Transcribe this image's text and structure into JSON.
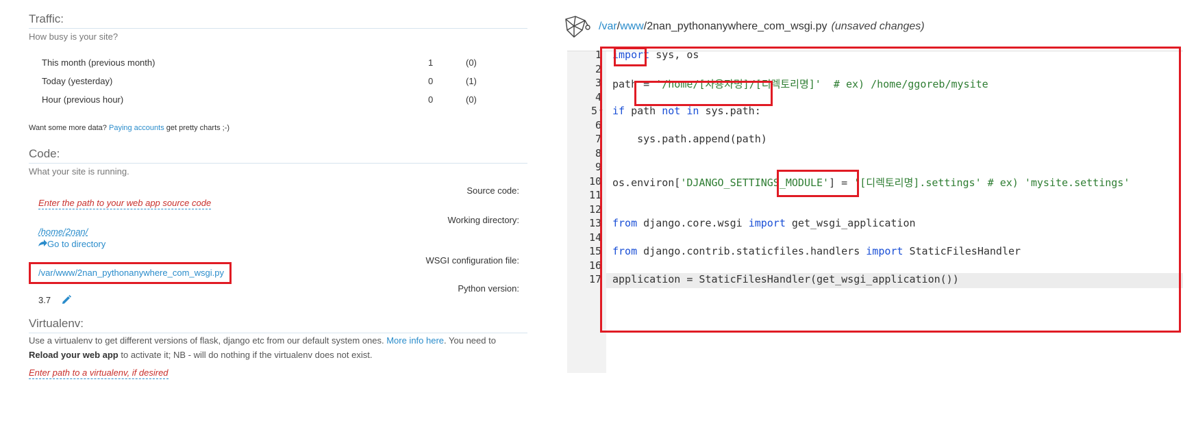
{
  "traffic": {
    "title": "Traffic:",
    "subtitle": "How busy is your site?",
    "rows": [
      {
        "label": "This month (previous month)",
        "value": "1",
        "previous": "(0)"
      },
      {
        "label": "Today (yesterday)",
        "value": "0",
        "previous": "(1)"
      },
      {
        "label": "Hour (previous hour)",
        "value": "0",
        "previous": "(0)"
      }
    ],
    "more_data_prefix": "Want some more data? ",
    "more_data_link": "Paying accounts",
    "more_data_suffix": " get pretty charts ;-)"
  },
  "code": {
    "title": "Code:",
    "subtitle": "What your site is running.",
    "source_label": "Source code:",
    "source_placeholder": "Enter the path to your web app source code",
    "working_label": "Working directory:",
    "working_value": "/home/2nan/",
    "goto_dir": "Go to directory",
    "wsgi_label": "WSGI configuration file:",
    "wsgi_value": "/var/www/2nan_pythonanywhere_com_wsgi.py",
    "python_label": "Python version:",
    "python_value": "3.7"
  },
  "virtualenv": {
    "title": "Virtualenv:",
    "text_1": "Use a virtualenv to get different versions of flask, django etc from our default system ones. ",
    "more_info": "More info here",
    "text_2": ". You need to ",
    "bold": "Reload your web app",
    "text_3": " to activate it; NB - will do nothing if the virtualenv does not exist.",
    "placeholder": "Enter path to a virtualenv, if desired"
  },
  "editor": {
    "path_dir_1": "/var",
    "path_sep": "/",
    "path_dir_2": "www",
    "path_file": "/2nan_pythonanywhere_com_wsgi.py",
    "unsaved": "(unsaved changes)",
    "line_numbers": [
      "1",
      "2",
      "3",
      "4",
      "5",
      "6",
      "7",
      "8",
      "9",
      "10",
      "11",
      "12",
      "13",
      "14",
      "15",
      "16",
      "17"
    ],
    "lines": {
      "l1_kw": "import",
      "l1_rest": " sys, os",
      "l3_a": "path = ",
      "l3_str": "'/home/[사용자명]/[디렉토리명]'",
      "l3_cm": "  # ex) /home/ggoreb/mysite",
      "l5_kw1": "if",
      "l5_a": " path ",
      "l5_kw2": "not in",
      "l5_b": " sys.path:",
      "l7": "    sys.path.append(path)",
      "l10_a": "os.environ[",
      "l10_str1": "'DJANGO_SETTINGS_MODULE'",
      "l10_b": "] = ",
      "l10_str2": "'[디렉토리명].settings'",
      "l10_cm": " # ex) 'mysite.settings'",
      "l13_kw1": "from",
      "l13_a": " django.core.wsgi ",
      "l13_kw2": "import",
      "l13_b": " get_wsgi_application",
      "l15_kw1": "from",
      "l15_a": " django.contrib.staticfiles.handlers ",
      "l15_kw2": "import",
      "l15_b": " StaticFilesHandler",
      "l17": "application = StaticFilesHandler(get_wsgi_application())"
    }
  },
  "colors": {
    "accent_link": "#2a8ccb",
    "highlight_red": "#e01b24",
    "placeholder_red": "#c9302c"
  }
}
